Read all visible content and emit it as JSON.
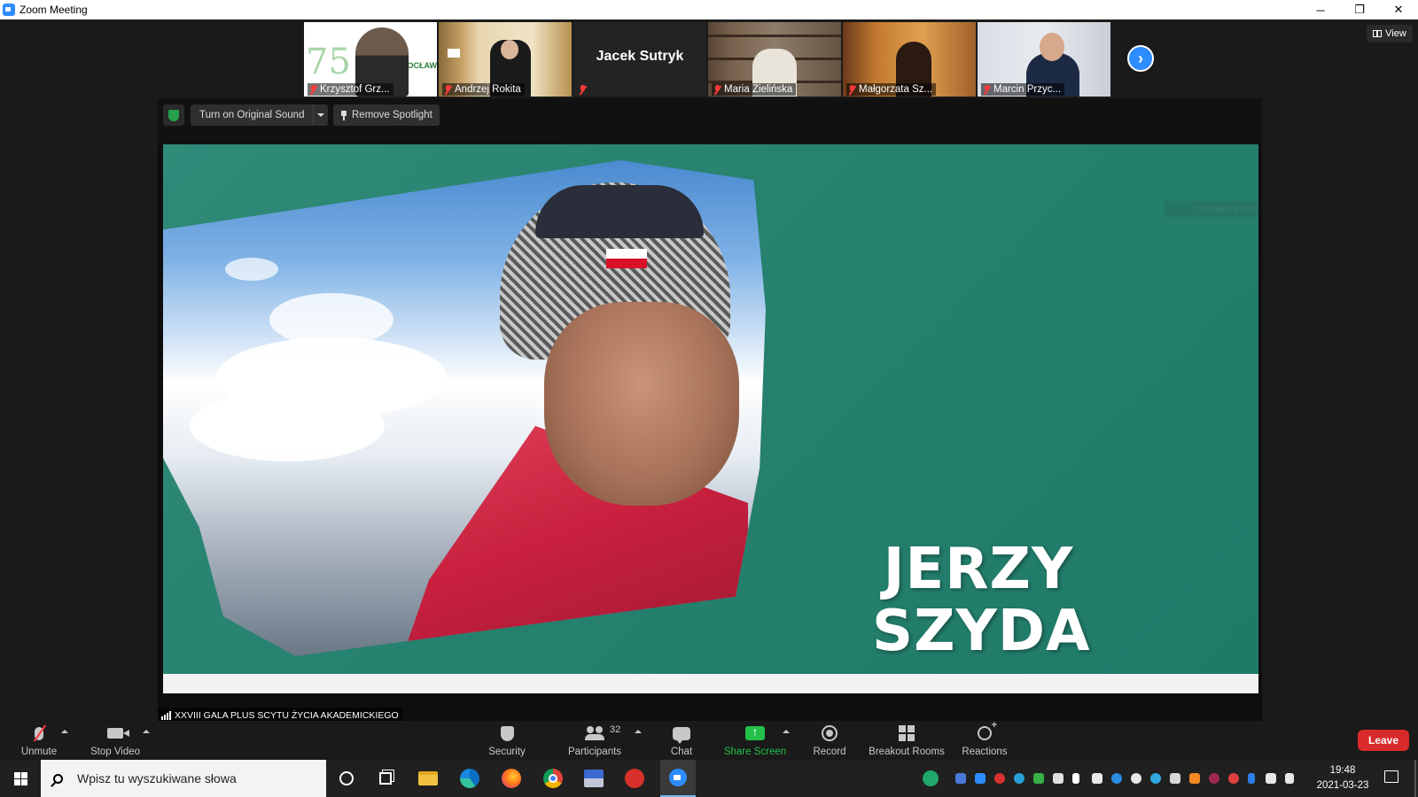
{
  "window": {
    "title": "Zoom Meeting",
    "minimize": "─",
    "restore": "❐",
    "close": "✕"
  },
  "participants_strip": [
    {
      "name": "Krzysztof Grz...",
      "muted": true,
      "logo_text": "AWF WROCŁAW",
      "logo_number": "75"
    },
    {
      "name": "Andrzej Rokita",
      "muted": true
    },
    {
      "name": "",
      "display_name": "Jacek Sutryk",
      "muted": true,
      "video_off": true
    },
    {
      "name": "Maria Zielińska",
      "muted": true
    },
    {
      "name": "Małgorzata Sz...",
      "muted": true
    },
    {
      "name": "Marcin Przyc...",
      "muted": true
    }
  ],
  "view_button": "View",
  "next_page": "›",
  "stage": {
    "original_sound": "Turn on Original Sound",
    "remove_spotlight": "Remove Spotlight",
    "overlay_name_line1": "JERZY",
    "overlay_name_line2": "SZYDA",
    "spotlight_label": "XXVIII GALA PLUS SCYTU ŻYCIA AKADEMICKIEGO",
    "faint_caption": "Wolbał na wokół ołowny"
  },
  "toolbar": {
    "unmute": "Unmute",
    "stop_video": "Stop Video",
    "security": "Security",
    "participants": "Participants",
    "participants_count": "32",
    "chat": "Chat",
    "share_screen": "Share Screen",
    "record": "Record",
    "breakout_rooms": "Breakout Rooms",
    "reactions": "Reactions",
    "leave": "Leave"
  },
  "taskbar": {
    "search_placeholder": "Wpisz tu wyszukiwane słowa",
    "time": "19:48",
    "date": "2021-03-23"
  },
  "colors": {
    "zoom_blue": "#2d8cff",
    "leave_red": "#d82a2a",
    "share_green": "#23c14a",
    "stage_green": "#27816f"
  }
}
